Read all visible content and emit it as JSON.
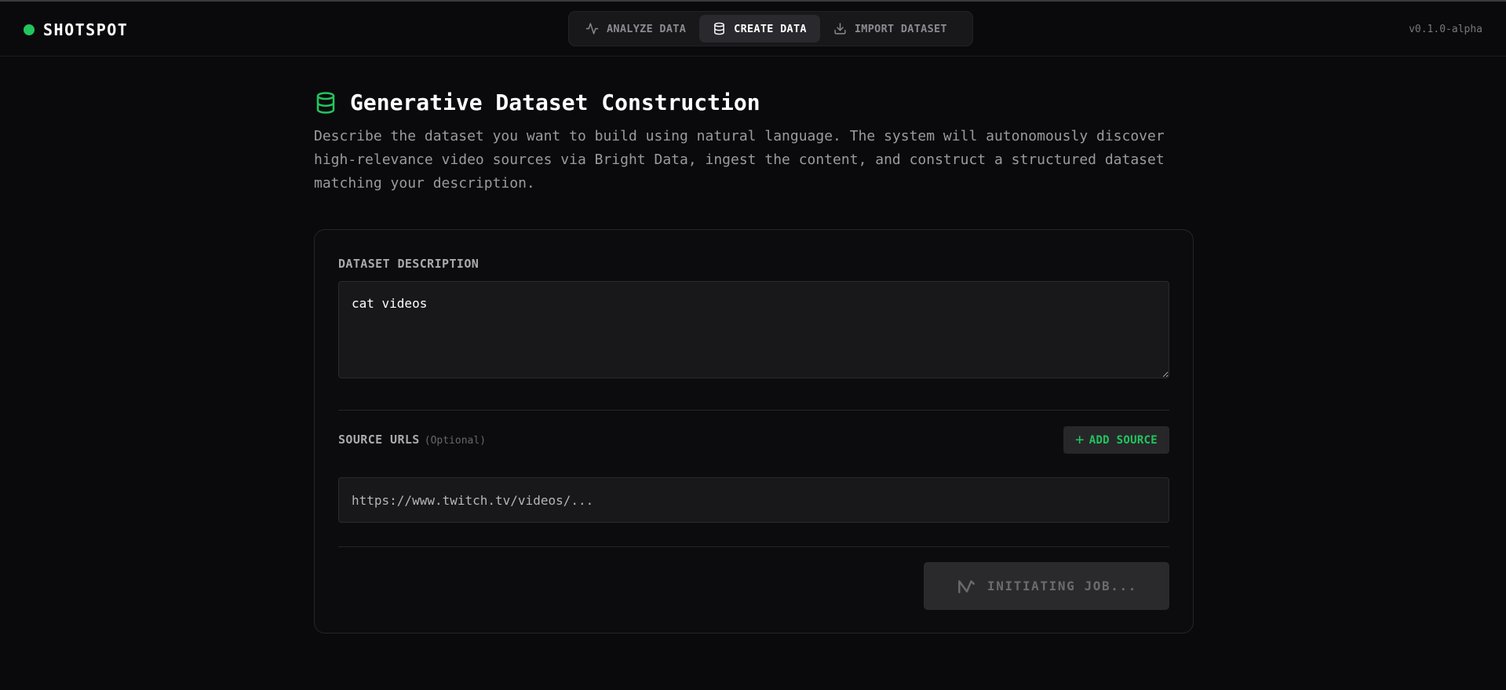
{
  "app": {
    "brand": "SHOTSPOT",
    "version": "v0.1.0-alpha",
    "accent_color": "#22c55e"
  },
  "nav": {
    "tabs": [
      {
        "label": "ANALYZE DATA",
        "icon": "activity-icon",
        "active": false
      },
      {
        "label": "CREATE DATA",
        "icon": "database-icon",
        "active": true
      },
      {
        "label": "IMPORT DATASET",
        "icon": "download-icon",
        "active": false
      }
    ]
  },
  "page": {
    "title": "Generative Dataset Construction",
    "title_icon": "database-icon",
    "description": "Describe the dataset you want to build using natural language. The system will autonomously discover high-relevance video sources via Bright Data, ingest the content, and construct a structured dataset matching your description."
  },
  "form": {
    "description_label": "DATASET DESCRIPTION",
    "description_value": "cat videos",
    "sources_label": "SOURCE URLS",
    "sources_optional": "(Optional)",
    "add_source_label": "ADD SOURCE",
    "url_placeholder": "https://www.twitch.tv/videos/...",
    "submit_label": "INITIATING JOB...",
    "submit_disabled": true
  }
}
